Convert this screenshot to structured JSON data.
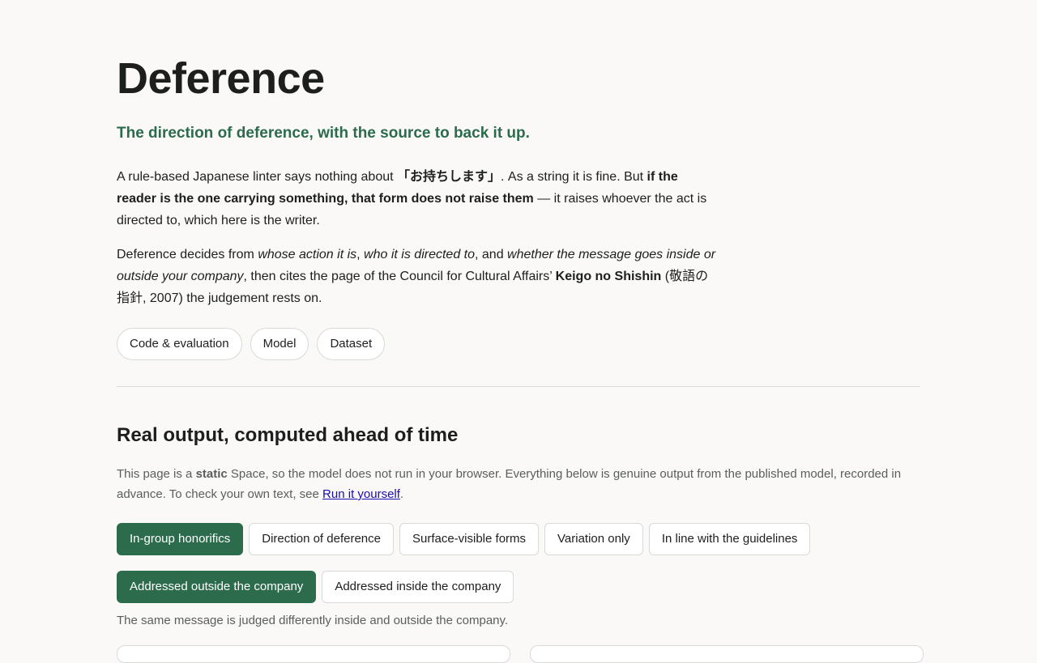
{
  "header": {
    "title": "Deference",
    "tagline": "The direction of deference, with the source to back it up."
  },
  "intro": {
    "p1": [
      {
        "t": "A rule-based Japanese linter says nothing about ",
        "s": ""
      },
      {
        "t": "「お持ちします」",
        "s": "b"
      },
      {
        "t": ". As a string it is fine. But ",
        "s": ""
      },
      {
        "t": "if the reader is the one carrying something, that form does not raise them",
        "s": "b"
      },
      {
        "t": " — it raises whoever the act is directed to, which here is the writer.",
        "s": ""
      }
    ],
    "p2": [
      {
        "t": "Deference decides from ",
        "s": ""
      },
      {
        "t": "whose action it is",
        "s": "i"
      },
      {
        "t": ", ",
        "s": ""
      },
      {
        "t": "who it is directed to",
        "s": "i"
      },
      {
        "t": ", and ",
        "s": ""
      },
      {
        "t": "whether the message goes inside or outside your company",
        "s": "i"
      },
      {
        "t": ", then cites the page of the Council for Cultural Affairs’ ",
        "s": ""
      },
      {
        "t": "Keigo no Shishin",
        "s": "b"
      },
      {
        "t": " (敬語の指針, 2007) the judgement rests on.",
        "s": ""
      }
    ]
  },
  "links": [
    "Code & evaluation",
    "Model",
    "Dataset"
  ],
  "section": {
    "title": "Real output, computed ahead of time",
    "note_before": "This page is a ",
    "note_bold": "static",
    "note_middle": " Space, so the model does not run in your browser. Everything below is genuine output from the published model, recorded in advance. To check your own text, see ",
    "note_link": "Run it yourself",
    "note_after": "."
  },
  "example_tabs": [
    {
      "label": "In-group honorifics",
      "active": true
    },
    {
      "label": "Direction of deference",
      "active": false
    },
    {
      "label": "Surface-visible forms",
      "active": false
    },
    {
      "label": "Variation only",
      "active": false
    },
    {
      "label": "In line with the guidelines",
      "active": false
    }
  ],
  "scope_tabs": [
    {
      "label": "Addressed outside the company",
      "active": true
    },
    {
      "label": "Addressed inside the company",
      "active": false
    }
  ],
  "caption": "The same message is judged differently inside and outside the company.",
  "colors": {
    "accent": "#2c6b4c",
    "link": "#1a0dab"
  }
}
